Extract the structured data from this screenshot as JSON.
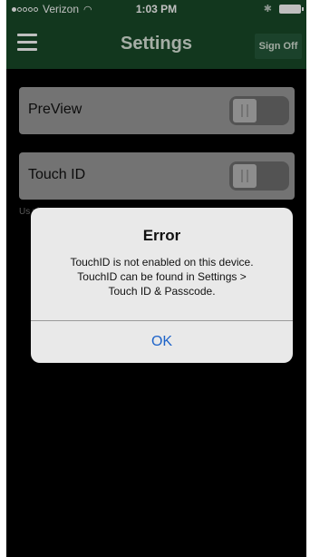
{
  "status_bar": {
    "carrier": "Verizon",
    "time": "1:03 PM",
    "wifi_icon": "wifi-icon",
    "bluetooth_icon": "bluetooth-icon",
    "battery_icon": "battery-icon"
  },
  "navbar": {
    "title": "Settings",
    "menu_icon": "hamburger-menu-icon",
    "sign_off": "Sign Off"
  },
  "settings": {
    "rows": [
      {
        "label": "PreView",
        "enabled": false
      },
      {
        "label": "Touch ID",
        "enabled": false
      }
    ],
    "help_text": "Us vie"
  },
  "alert": {
    "title": "Error",
    "message_lines": [
      "TouchID is not enabled on this device.",
      "TouchID can be found in Settings >",
      "Touch ID & Passcode."
    ],
    "ok_label": "OK"
  },
  "colors": {
    "header_bg": "#184a28",
    "row_bg": "#9a9a9a",
    "alert_bg": "#e9e9e9",
    "link_blue": "#1d63c9"
  }
}
